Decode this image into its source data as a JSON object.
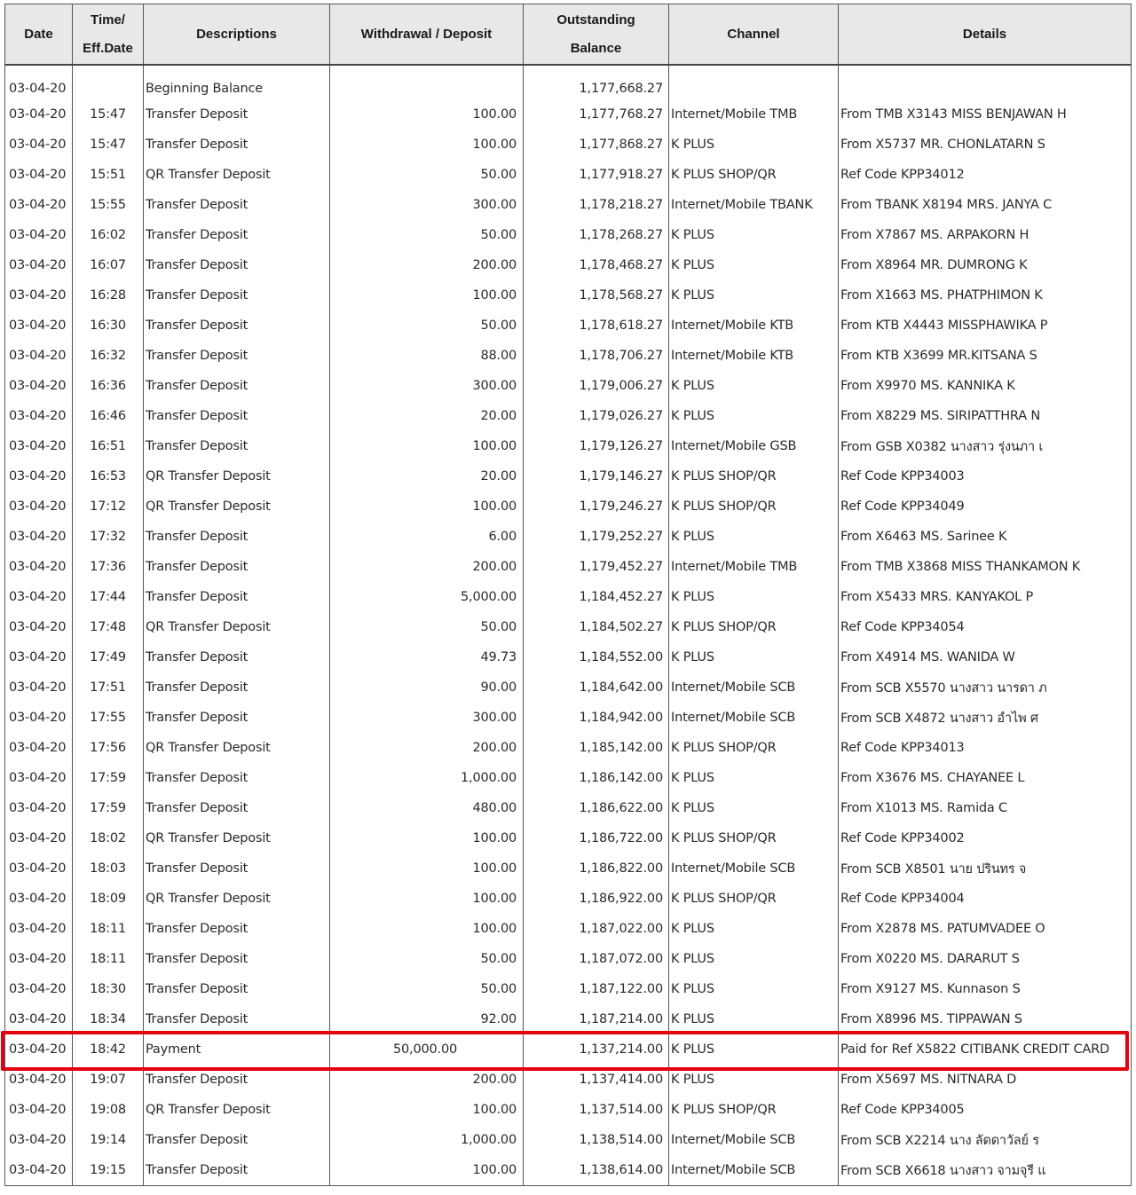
{
  "headers": {
    "date": "Date",
    "time_line1": "Time/",
    "time_line2": "Eff.Date",
    "descriptions": "Descriptions",
    "withdrawal_deposit": "Withdrawal / Deposit",
    "balance_line1": "Outstanding",
    "balance_line2": "Balance",
    "channel": "Channel",
    "details": "Details"
  },
  "highlight_color": "#e3000f",
  "highlighted_row_index": 32,
  "rows": [
    {
      "date": "03-04-20",
      "time": "",
      "desc": "Beginning Balance",
      "amount": "",
      "balance": "1,177,668.27",
      "channel": "",
      "details": ""
    },
    {
      "date": "03-04-20",
      "time": "15:47",
      "desc": "Transfer Deposit",
      "amount": "100.00",
      "balance": "1,177,768.27",
      "channel": "Internet/Mobile TMB",
      "details": "From TMB X3143 MISS BENJAWAN H"
    },
    {
      "date": "03-04-20",
      "time": "15:47",
      "desc": "Transfer Deposit",
      "amount": "100.00",
      "balance": "1,177,868.27",
      "channel": "K PLUS",
      "details": "From X5737 MR. CHONLATARN S"
    },
    {
      "date": "03-04-20",
      "time": "15:51",
      "desc": "QR Transfer Deposit",
      "amount": "50.00",
      "balance": "1,177,918.27",
      "channel": "K PLUS SHOP/QR",
      "details": "Ref Code KPP34012"
    },
    {
      "date": "03-04-20",
      "time": "15:55",
      "desc": "Transfer Deposit",
      "amount": "300.00",
      "balance": "1,178,218.27",
      "channel": "Internet/Mobile TBANK",
      "details": "From TBANK X8194 MRS. JANYA C"
    },
    {
      "date": "03-04-20",
      "time": "16:02",
      "desc": "Transfer Deposit",
      "amount": "50.00",
      "balance": "1,178,268.27",
      "channel": "K PLUS",
      "details": "From X7867 MS. ARPAKORN H"
    },
    {
      "date": "03-04-20",
      "time": "16:07",
      "desc": "Transfer Deposit",
      "amount": "200.00",
      "balance": "1,178,468.27",
      "channel": "K PLUS",
      "details": "From X8964 MR. DUMRONG K"
    },
    {
      "date": "03-04-20",
      "time": "16:28",
      "desc": "Transfer Deposit",
      "amount": "100.00",
      "balance": "1,178,568.27",
      "channel": "K PLUS",
      "details": "From X1663 MS. PHATPHIMON K"
    },
    {
      "date": "03-04-20",
      "time": "16:30",
      "desc": "Transfer Deposit",
      "amount": "50.00",
      "balance": "1,178,618.27",
      "channel": "Internet/Mobile KTB",
      "details": "From KTB X4443 MISSPHAWIKA P"
    },
    {
      "date": "03-04-20",
      "time": "16:32",
      "desc": "Transfer Deposit",
      "amount": "88.00",
      "balance": "1,178,706.27",
      "channel": "Internet/Mobile KTB",
      "details": "From KTB X3699 MR.KITSANA S"
    },
    {
      "date": "03-04-20",
      "time": "16:36",
      "desc": "Transfer Deposit",
      "amount": "300.00",
      "balance": "1,179,006.27",
      "channel": "K PLUS",
      "details": "From X9970 MS. KANNIKA K"
    },
    {
      "date": "03-04-20",
      "time": "16:46",
      "desc": "Transfer Deposit",
      "amount": "20.00",
      "balance": "1,179,026.27",
      "channel": "K PLUS",
      "details": "From X8229 MS. SIRIPATTHRA N"
    },
    {
      "date": "03-04-20",
      "time": "16:51",
      "desc": "Transfer Deposit",
      "amount": "100.00",
      "balance": "1,179,126.27",
      "channel": "Internet/Mobile GSB",
      "details": "From GSB X0382 นางสาว รุ่งนภา เ"
    },
    {
      "date": "03-04-20",
      "time": "16:53",
      "desc": "QR Transfer Deposit",
      "amount": "20.00",
      "balance": "1,179,146.27",
      "channel": "K PLUS SHOP/QR",
      "details": "Ref Code KPP34003"
    },
    {
      "date": "03-04-20",
      "time": "17:12",
      "desc": "QR Transfer Deposit",
      "amount": "100.00",
      "balance": "1,179,246.27",
      "channel": "K PLUS SHOP/QR",
      "details": "Ref Code KPP34049"
    },
    {
      "date": "03-04-20",
      "time": "17:32",
      "desc": "Transfer Deposit",
      "amount": "6.00",
      "balance": "1,179,252.27",
      "channel": "K PLUS",
      "details": "From X6463 MS. Sarinee K"
    },
    {
      "date": "03-04-20",
      "time": "17:36",
      "desc": "Transfer Deposit",
      "amount": "200.00",
      "balance": "1,179,452.27",
      "channel": "Internet/Mobile TMB",
      "details": "From TMB X3868 MISS THANKAMON K"
    },
    {
      "date": "03-04-20",
      "time": "17:44",
      "desc": "Transfer Deposit",
      "amount": "5,000.00",
      "balance": "1,184,452.27",
      "channel": "K PLUS",
      "details": "From X5433 MRS. KANYAKOL P"
    },
    {
      "date": "03-04-20",
      "time": "17:48",
      "desc": "QR Transfer Deposit",
      "amount": "50.00",
      "balance": "1,184,502.27",
      "channel": "K PLUS SHOP/QR",
      "details": "Ref Code KPP34054"
    },
    {
      "date": "03-04-20",
      "time": "17:49",
      "desc": "Transfer Deposit",
      "amount": "49.73",
      "balance": "1,184,552.00",
      "channel": "K PLUS",
      "details": "From X4914 MS. WANIDA W"
    },
    {
      "date": "03-04-20",
      "time": "17:51",
      "desc": "Transfer Deposit",
      "amount": "90.00",
      "balance": "1,184,642.00",
      "channel": "Internet/Mobile SCB",
      "details": "From SCB X5570 นางสาว นารดา ภ"
    },
    {
      "date": "03-04-20",
      "time": "17:55",
      "desc": "Transfer Deposit",
      "amount": "300.00",
      "balance": "1,184,942.00",
      "channel": "Internet/Mobile SCB",
      "details": "From SCB X4872 นางสาว อำไพ ศ"
    },
    {
      "date": "03-04-20",
      "time": "17:56",
      "desc": "QR Transfer Deposit",
      "amount": "200.00",
      "balance": "1,185,142.00",
      "channel": "K PLUS SHOP/QR",
      "details": "Ref Code KPP34013"
    },
    {
      "date": "03-04-20",
      "time": "17:59",
      "desc": "Transfer Deposit",
      "amount": "1,000.00",
      "balance": "1,186,142.00",
      "channel": "K PLUS",
      "details": "From X3676 MS. CHAYANEE L"
    },
    {
      "date": "03-04-20",
      "time": "17:59",
      "desc": "Transfer Deposit",
      "amount": "480.00",
      "balance": "1,186,622.00",
      "channel": "K PLUS",
      "details": "From X1013 MS. Ramida C"
    },
    {
      "date": "03-04-20",
      "time": "18:02",
      "desc": "QR Transfer Deposit",
      "amount": "100.00",
      "balance": "1,186,722.00",
      "channel": "K PLUS SHOP/QR",
      "details": "Ref Code KPP34002"
    },
    {
      "date": "03-04-20",
      "time": "18:03",
      "desc": "Transfer Deposit",
      "amount": "100.00",
      "balance": "1,186,822.00",
      "channel": "Internet/Mobile SCB",
      "details": "From SCB X8501 นาย ปรินทร จ"
    },
    {
      "date": "03-04-20",
      "time": "18:09",
      "desc": "QR Transfer Deposit",
      "amount": "100.00",
      "balance": "1,186,922.00",
      "channel": "K PLUS SHOP/QR",
      "details": "Ref Code KPP34004"
    },
    {
      "date": "03-04-20",
      "time": "18:11",
      "desc": "Transfer Deposit",
      "amount": "100.00",
      "balance": "1,187,022.00",
      "channel": "K PLUS",
      "details": "From X2878 MS. PATUMVADEE O"
    },
    {
      "date": "03-04-20",
      "time": "18:11",
      "desc": "Transfer Deposit",
      "amount": "50.00",
      "balance": "1,187,072.00",
      "channel": "K PLUS",
      "details": "From X0220 MS. DARARUT S"
    },
    {
      "date": "03-04-20",
      "time": "18:30",
      "desc": "Transfer Deposit",
      "amount": "50.00",
      "balance": "1,187,122.00",
      "channel": "K PLUS",
      "details": "From X9127 MS. Kunnason S"
    },
    {
      "date": "03-04-20",
      "time": "18:34",
      "desc": "Transfer Deposit",
      "amount": "92.00",
      "balance": "1,187,214.00",
      "channel": "K PLUS",
      "details": "From X8996 MS. TIPPAWAN S"
    },
    {
      "date": "03-04-20",
      "time": "18:42",
      "desc": "Payment",
      "amount": "50,000.00",
      "balance": "1,137,214.00",
      "channel": "K PLUS",
      "details": "Paid for Ref X5822 CITIBANK CREDIT CARD",
      "withdrawal": true
    },
    {
      "date": "03-04-20",
      "time": "19:07",
      "desc": "Transfer Deposit",
      "amount": "200.00",
      "balance": "1,137,414.00",
      "channel": "K PLUS",
      "details": "From X5697 MS. NITNARA D"
    },
    {
      "date": "03-04-20",
      "time": "19:08",
      "desc": "QR Transfer Deposit",
      "amount": "100.00",
      "balance": "1,137,514.00",
      "channel": "K PLUS SHOP/QR",
      "details": "Ref Code KPP34005"
    },
    {
      "date": "03-04-20",
      "time": "19:14",
      "desc": "Transfer Deposit",
      "amount": "1,000.00",
      "balance": "1,138,514.00",
      "channel": "Internet/Mobile SCB",
      "details": "From SCB X2214 นาง ลัดดาวัลย์ ร"
    },
    {
      "date": "03-04-20",
      "time": "19:15",
      "desc": "Transfer Deposit",
      "amount": "100.00",
      "balance": "1,138,614.00",
      "channel": "Internet/Mobile SCB",
      "details": "From SCB X6618 นางสาว จามจุรี แ"
    }
  ]
}
